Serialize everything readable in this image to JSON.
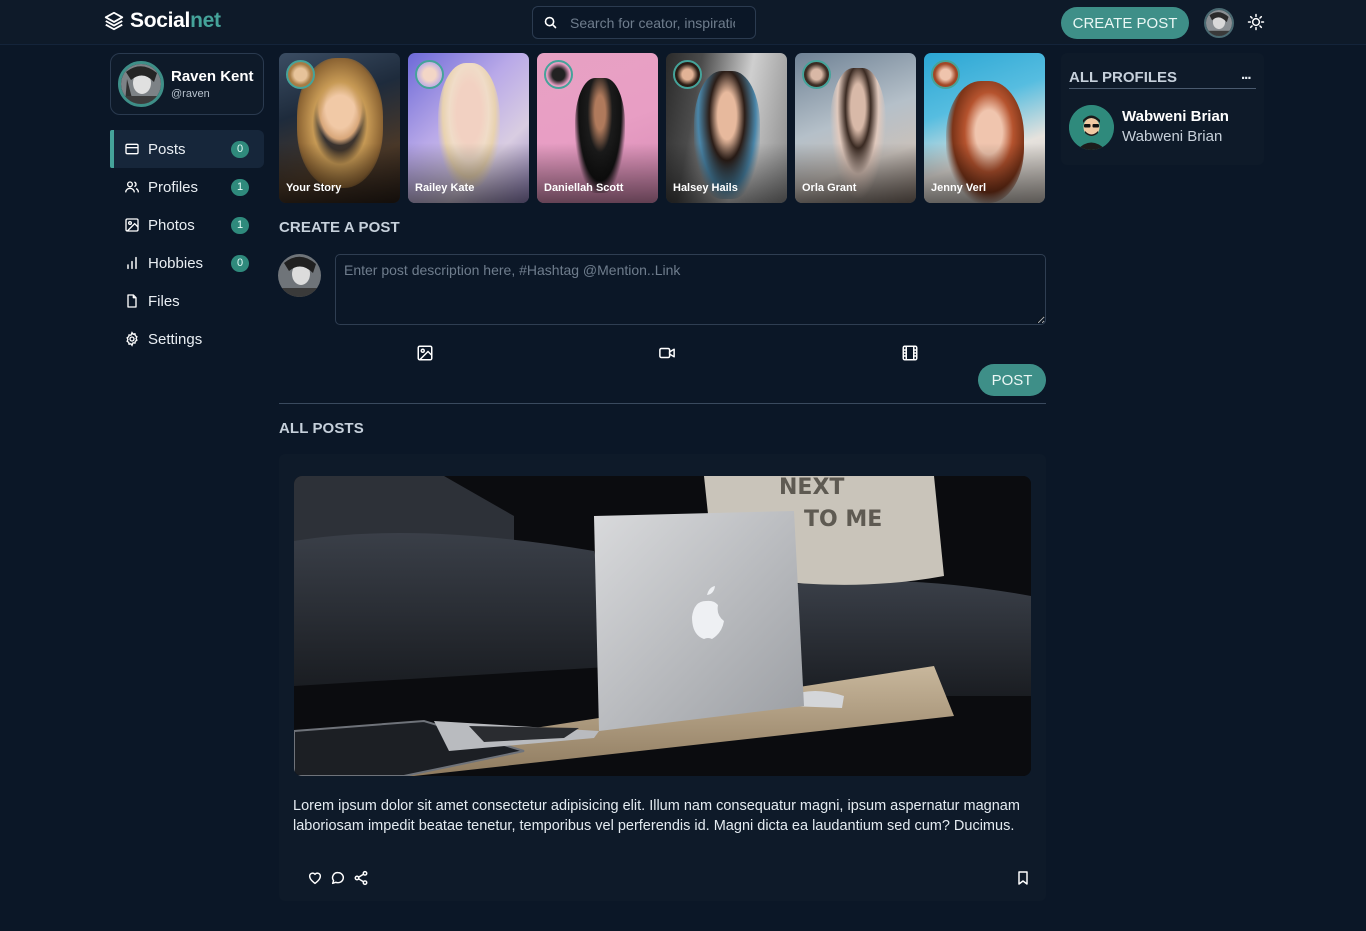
{
  "brand": {
    "name_primary": "Social",
    "name_accent": "net"
  },
  "search": {
    "placeholder": "Search for ceator, inspiration..."
  },
  "header": {
    "create_post_label": "CREATE POST"
  },
  "profile": {
    "name": "Raven Kent",
    "handle": "@raven"
  },
  "nav": [
    {
      "label": "Posts",
      "count": "0",
      "icon": "posts-icon"
    },
    {
      "label": "Profiles",
      "count": "1",
      "icon": "users-icon"
    },
    {
      "label": "Photos",
      "count": "1",
      "icon": "image-icon"
    },
    {
      "label": "Hobbies",
      "count": "0",
      "icon": "bar-chart-icon"
    },
    {
      "label": "Files",
      "count": "",
      "icon": "file-icon"
    },
    {
      "label": "Settings",
      "count": "",
      "icon": "gear-icon"
    }
  ],
  "stories": [
    {
      "name": "Your Story"
    },
    {
      "name": "Railey Kate"
    },
    {
      "name": "Daniellah Scott"
    },
    {
      "name": "Halsey Hails"
    },
    {
      "name": "Orla Grant"
    },
    {
      "name": "Jenny Verl"
    }
  ],
  "create_post": {
    "title": "CREATE A POST",
    "placeholder": "Enter post description here, #Hashtag @Mention..Link",
    "post_label": "POST"
  },
  "all_posts": {
    "title": "ALL POSTS",
    "posts": [
      {
        "text": "Lorem ipsum dolor sit amet consectetur adipisicing elit. Illum nam consequatur magni, ipsum aspernatur magnam laboriosam impedit beatae tenetur, temporibus vel perferendis id. Magni dicta ea laudantium sed cum? Ducimus.",
        "pillow_text": "NEXT TO ME"
      }
    ]
  },
  "profiles_panel": {
    "title": "ALL PROFILES",
    "more": "...",
    "items": [
      {
        "name": "Wabweni Brian",
        "subtitle": "Wabweni Brian"
      }
    ]
  },
  "colors": {
    "accent": "#3e8f88",
    "background": "#0b1727",
    "panel": "#0e1a29"
  }
}
